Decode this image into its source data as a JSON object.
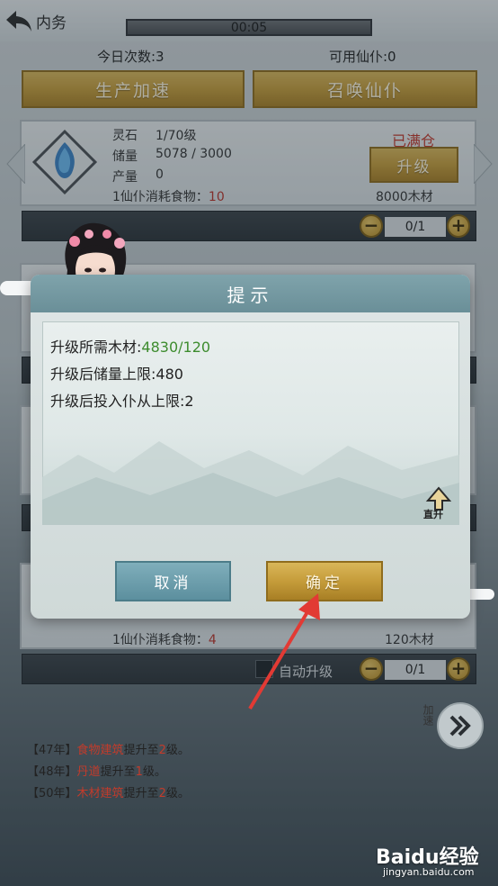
{
  "header": {
    "back_label": "内务",
    "timer": "00:05"
  },
  "stats": {
    "today_count": "今日次数:3",
    "available": "可用仙仆:0"
  },
  "actions": {
    "speed_up": "生产加速",
    "summon": "召唤仙仆"
  },
  "card1": {
    "name": "灵石",
    "level": "1/70级",
    "storage_label": "储量",
    "storage_value": "5078 / 3000",
    "output_label": "产量",
    "output_value": "0",
    "consume_label": "1仙仆消耗食物：",
    "consume_value": "10",
    "status": "已满仓",
    "upgrade_label": "升级",
    "cost": "8000木材",
    "counter": "0/1"
  },
  "card_bottom": {
    "consume_label": "1仙仆消耗食物：",
    "consume_value": "4",
    "cost": "120木材",
    "auto_upgrade": "自动升级",
    "counter": "0/1"
  },
  "dialog": {
    "title": "提示",
    "line1_label": "升级所需木材:",
    "line1_value": "4830/120",
    "line2": "升级后储量上限:480",
    "line3": "升级后投入仆从上限:2",
    "direct_up": "直升",
    "cancel": "取消",
    "confirm": "确定"
  },
  "speed": {
    "label": "加速",
    "icon": "double-chevron-icon"
  },
  "log": [
    {
      "year": "【47年】",
      "item": "食物建筑",
      "mid": "提升至",
      "level": "2",
      "end": "级。"
    },
    {
      "year": "【48年】",
      "item": "丹道",
      "mid": "提升至",
      "level": "1",
      "end": "级。"
    },
    {
      "year": "【50年】",
      "item": "木材建筑",
      "mid": "提升至",
      "level": "2",
      "end": "级。"
    }
  ],
  "watermark": {
    "brand": "Baidu经验",
    "url": "jingyan.baidu.com"
  },
  "colors": {
    "accent_gold": "#c59c3a",
    "teal": "#6a8f98",
    "red": "#b8342a",
    "green": "#3d8c2e"
  }
}
